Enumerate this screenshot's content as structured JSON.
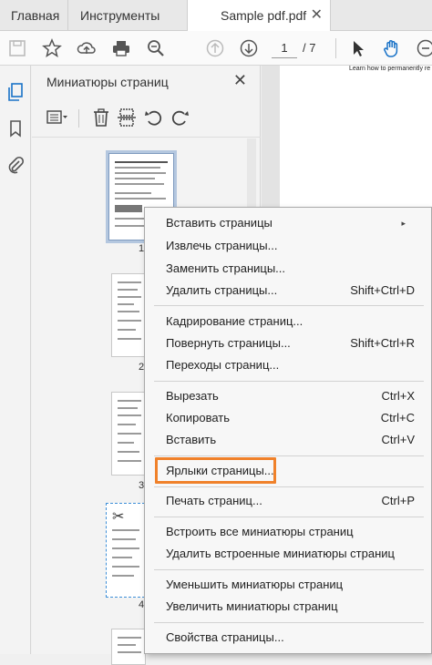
{
  "tabs": {
    "home": "Главная",
    "tools": "Инструменты",
    "document": "Sample pdf.pdf",
    "close": "✕"
  },
  "toolbar": {
    "current_page": "1",
    "total_pages": "/ 7",
    "icons": [
      "save-icon",
      "star-icon",
      "upload-icon",
      "print-icon",
      "zoom-icon",
      "page-up-icon",
      "page-down-icon",
      "select-arrow-icon",
      "hand-icon",
      "zoom-out-icon"
    ]
  },
  "panel": {
    "title": "Миниатюры страниц",
    "close": "✕",
    "thumbnails": [
      "1",
      "2",
      "3",
      "4"
    ]
  },
  "document": {
    "header_text": "Learn how to permanently re"
  },
  "context_menu": {
    "items": [
      {
        "label": "Вставить страницы",
        "shortcut": "",
        "submenu": true
      },
      {
        "label": "Извлечь страницы...",
        "shortcut": ""
      },
      {
        "label": "Заменить страницы...",
        "shortcut": ""
      },
      {
        "label": "Удалить страницы...",
        "shortcut": "Shift+Ctrl+D"
      },
      {
        "label": "Кадрирование страниц...",
        "shortcut": ""
      },
      {
        "label": "Повернуть страницы...",
        "shortcut": "Shift+Ctrl+R"
      },
      {
        "label": "Переходы страниц...",
        "shortcut": ""
      },
      {
        "label": "Вырезать",
        "shortcut": "Ctrl+X"
      },
      {
        "label": "Копировать",
        "shortcut": "Ctrl+C"
      },
      {
        "label": "Вставить",
        "shortcut": "Ctrl+V"
      },
      {
        "label": "Ярлыки страницы...",
        "shortcut": ""
      },
      {
        "label": "Печать страниц...",
        "shortcut": "Ctrl+P"
      },
      {
        "label": "Встроить все миниатюры страниц",
        "shortcut": ""
      },
      {
        "label": "Удалить встроенные миниатюры страниц",
        "shortcut": ""
      },
      {
        "label": "Уменьшить миниатюры страниц",
        "shortcut": ""
      },
      {
        "label": "Увеличить миниатюры страниц",
        "shortcut": ""
      },
      {
        "label": "Свойства страницы...",
        "shortcut": ""
      }
    ],
    "submenu_arrow": "▸"
  },
  "colors": {
    "highlight": "#f0812a",
    "accent_blue": "#1a73c8"
  }
}
